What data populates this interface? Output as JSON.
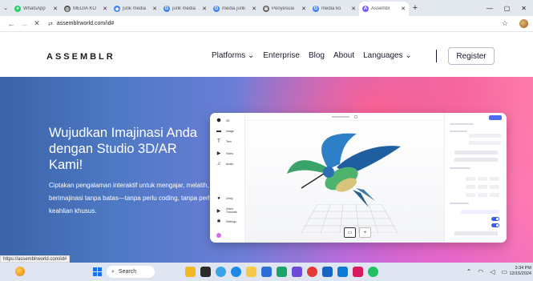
{
  "browser": {
    "tabs": [
      {
        "title": "WhatsApp",
        "icon": "whatsapp-icon",
        "color": "#25d366",
        "glyph": "●"
      },
      {
        "title": "MEDIA KO",
        "icon": "media-icon",
        "color": "#555555",
        "glyph": "◎"
      },
      {
        "title": "jurik media",
        "icon": "jurik-icon",
        "color": "#4285f4",
        "glyph": "◆"
      },
      {
        "title": "jurik media",
        "icon": "google-icon",
        "color": "#4285f4",
        "glyph": "G"
      },
      {
        "title": "media jurik",
        "icon": "google-icon",
        "color": "#4285f4",
        "glyph": "G"
      },
      {
        "title": "Penyesuai",
        "icon": "gear-icon",
        "color": "#666666",
        "glyph": "✻"
      },
      {
        "title": "media ko",
        "icon": "google-icon",
        "color": "#4285f4",
        "glyph": "G"
      },
      {
        "title": "Assembl",
        "icon": "assemblr-icon",
        "color": "#7a5cff",
        "glyph": "A"
      }
    ],
    "new_tab": "+",
    "url": "assemblrworld.com/id#"
  },
  "site": {
    "logo": "ASSEMBLR",
    "nav": [
      "Platforms ⌄",
      "Enterprise",
      "Blog",
      "About",
      "Languages ⌄"
    ],
    "register": "Register"
  },
  "hero": {
    "title": "Wujudkan Imajinasi Anda dengan Studio 3D/AR Kami!",
    "subtitle": "Ciptakan pengalaman interaktif untuk mengajar, melatih, dan berimajinasi tanpa batas—tanpa perlu coding, tanpa perlu keahlian khusus."
  },
  "editor": {
    "tools": [
      {
        "label": "3D",
        "icon": "cube-icon",
        "glyph": "⬢"
      },
      {
        "label": "Image",
        "icon": "image-icon",
        "glyph": "▬"
      },
      {
        "label": "Text",
        "icon": "text-icon",
        "glyph": "T"
      },
      {
        "label": "Video",
        "icon": "video-icon",
        "glyph": "▶"
      },
      {
        "label": "Audio",
        "icon": "music-icon",
        "glyph": "♫"
      },
      {
        "label": "Zenly",
        "icon": "pin-icon",
        "glyph": "●"
      },
      {
        "label": "Video Tutorials",
        "icon": "tutorial-icon",
        "glyph": "▶"
      },
      {
        "label": "Settings",
        "icon": "settings-icon",
        "glyph": "✱"
      }
    ]
  },
  "status_url": "https://assemblrworld.com/id#",
  "taskbar": {
    "search": "Search",
    "time": "3:34 PM",
    "date": "12/15/2024"
  },
  "colors": {
    "accent": "#3d5ce8",
    "hero_left": "#3a63a8",
    "hero_right": "#ff7aa8"
  }
}
